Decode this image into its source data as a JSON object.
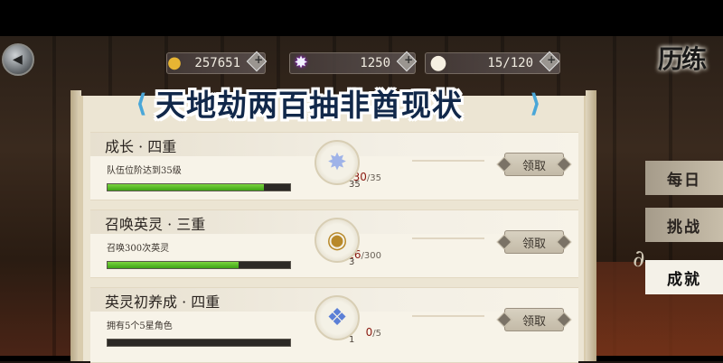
{
  "top_bar": {
    "resources": [
      {
        "icon": "gold-coin-icon",
        "value": "257651"
      },
      {
        "icon": "star-jade-icon",
        "value": "1250"
      },
      {
        "icon": "stamina-bun-icon",
        "value": "15/120"
      }
    ],
    "page_title": "历练"
  },
  "banner": {
    "text": "天地劫两百抽非酋现状"
  },
  "tasks": [
    {
      "title": "成长 · 四重",
      "desc": "队伍位阶达到35级",
      "current": "30",
      "max": "/35",
      "fraction": 0.857,
      "reward_icon": "star-jade-icon",
      "reward_count": "35",
      "claim_label": "领取"
    },
    {
      "title": "召唤英灵 · 三重",
      "desc": "召唤300次英灵",
      "current": "216",
      "max": "/300",
      "fraction": 0.72,
      "reward_icon": "gold-token-icon",
      "reward_count": "3",
      "claim_label": "领取"
    },
    {
      "title": "英灵初养成 · 四重",
      "desc": "拥有5个5星角色",
      "current": "0",
      "max": "/5",
      "fraction": 0.0,
      "reward_icon": "spirit-crystal-icon",
      "reward_count": "1",
      "claim_label": "领取"
    }
  ],
  "side_tabs": [
    {
      "label": "每日",
      "active": false
    },
    {
      "label": "挑战",
      "active": false
    },
    {
      "label": "成就",
      "active": true
    }
  ],
  "colors": {
    "progress": "#52b623",
    "banner_text": "#11284a",
    "panel": "#ece5d3"
  }
}
